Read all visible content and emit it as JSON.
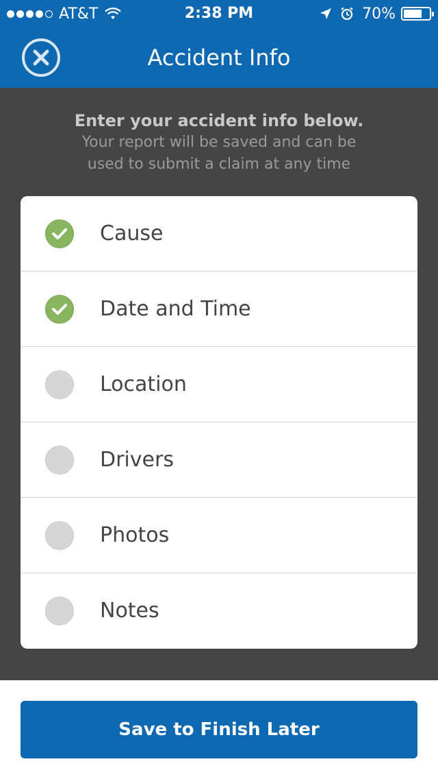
{
  "status_bar": {
    "carrier": "AT&T",
    "time": "2:38 PM",
    "battery": "70%"
  },
  "nav": {
    "title": "Accident Info"
  },
  "intro": {
    "title": "Enter your accident info below.",
    "subtitle_line1": "Your report will be saved and can be",
    "subtitle_line2": "used to submit a claim at any time"
  },
  "checklist": [
    {
      "label": "Cause",
      "completed": true
    },
    {
      "label": "Date and Time",
      "completed": true
    },
    {
      "label": "Location",
      "completed": false
    },
    {
      "label": "Drivers",
      "completed": false
    },
    {
      "label": "Photos",
      "completed": false
    },
    {
      "label": "Notes",
      "completed": false
    }
  ],
  "actions": {
    "save_label": "Save to Finish Later"
  },
  "colors": {
    "brand_blue": "#0e68b2",
    "check_green": "#8ab560",
    "pending_gray": "#d6d6d6"
  }
}
